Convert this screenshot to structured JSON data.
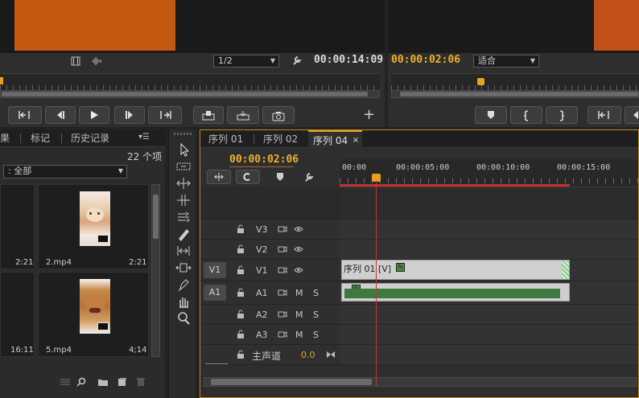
{
  "source_monitor": {
    "zoom": "1/2",
    "timecode": "00:00:14:09"
  },
  "program_monitor": {
    "timecode": "00:00:02:06",
    "fit": "适合"
  },
  "project_panel": {
    "tabs": [
      "果",
      "标记",
      "历史记录"
    ],
    "item_count": "22 个项",
    "filter": "全部",
    "clips": [
      {
        "name": "",
        "duration": "2:21"
      },
      {
        "name": "2.mp4",
        "duration": "2:21"
      },
      {
        "name": "",
        "duration": "16:11"
      },
      {
        "name": "5.mp4",
        "duration": "4;14"
      }
    ]
  },
  "timeline": {
    "tabs": [
      "序列 01",
      "序列 02",
      "序列 04"
    ],
    "timecode": "00:00:02:06",
    "ruler_labels": [
      "00:00",
      "00:00:05:00",
      "00:00:10:00",
      "00:00:15:00"
    ],
    "video_tracks": [
      "V3",
      "V2",
      "V1"
    ],
    "audio_tracks": [
      "A1",
      "A2",
      "A3"
    ],
    "source_patch_v": "V1",
    "source_patch_a": "A1",
    "mute_label": "M",
    "solo_label": "S",
    "master_track": "主声道",
    "master_value": "0.0",
    "video_clip_label": "序列 01 [V]",
    "fx_label": "fx"
  },
  "colors": {
    "accent_yellow": "#f0b02c",
    "playhead_red": "#d03030",
    "orange_frame": "#c45a10"
  }
}
